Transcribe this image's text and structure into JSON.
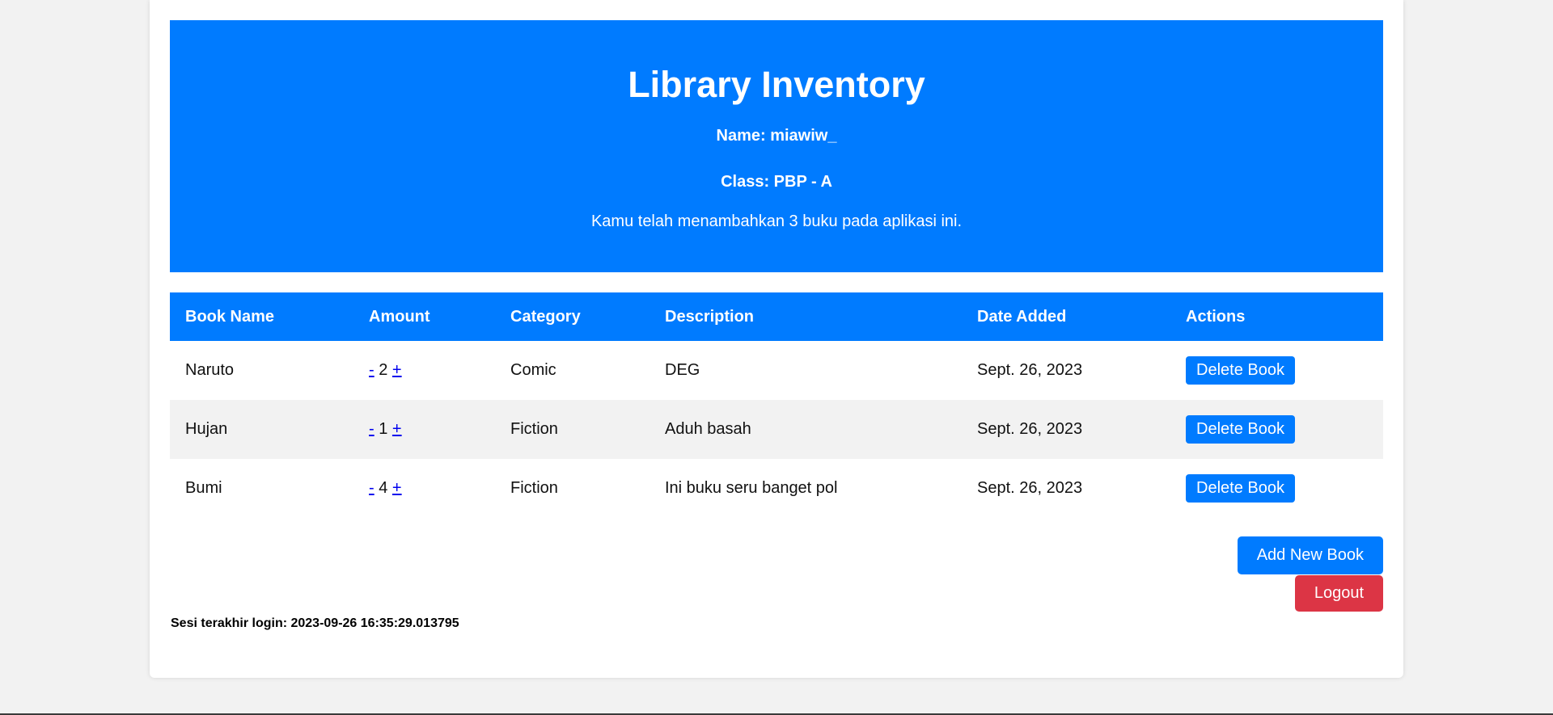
{
  "header": {
    "title": "Library Inventory",
    "name": "Name: miawiw_",
    "class": "Class: PBP - A",
    "note": "Kamu telah menambahkan 3 buku pada aplikasi ini."
  },
  "table": {
    "columns": [
      "Book Name",
      "Amount",
      "Category",
      "Description",
      "Date Added",
      "Actions"
    ],
    "rows": [
      {
        "name": "Naruto",
        "minus": "-",
        "amount": "2",
        "plus": "+",
        "category": "Comic",
        "description": "DEG",
        "date": "Sept. 26, 2023",
        "action": "Delete Book"
      },
      {
        "name": "Hujan",
        "minus": "-",
        "amount": "1",
        "plus": "+",
        "category": "Fiction",
        "description": "Aduh basah",
        "date": "Sept. 26, 2023",
        "action": "Delete Book"
      },
      {
        "name": "Bumi",
        "minus": "-",
        "amount": "4",
        "plus": "+",
        "category": "Fiction",
        "description": "Ini buku seru banget pol",
        "date": "Sept. 26, 2023",
        "action": "Delete Book"
      }
    ]
  },
  "buttons": {
    "add": "Add New Book",
    "logout": "Logout"
  },
  "footer": {
    "last_login": "Sesi terakhir login: 2023-09-26 16:35:29.013795"
  },
  "colors": {
    "primary": "#007bff",
    "danger": "#dc3545",
    "stripe": "#f2f2f2"
  }
}
